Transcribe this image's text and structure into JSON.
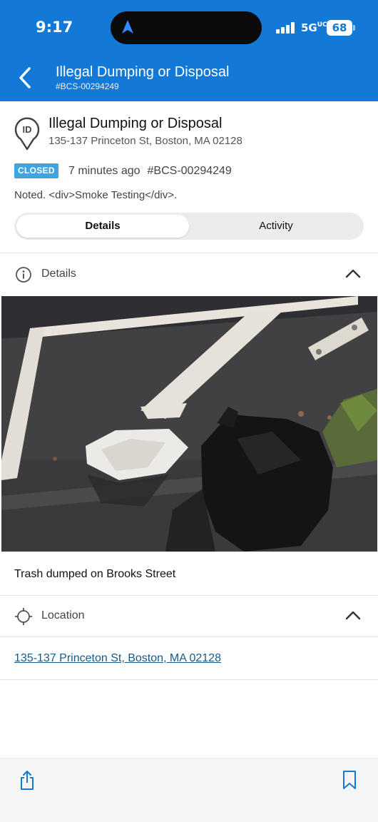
{
  "status_bar": {
    "time": "9:17",
    "network": "5G",
    "network_sup": "UC",
    "battery": "68"
  },
  "nav": {
    "title": "Illegal Dumping or Disposal",
    "subtitle": "#BCS-00294249"
  },
  "case": {
    "title": "Illegal Dumping or Disposal",
    "address": "135-137 Princeton St, Boston, MA 02128",
    "pin_label": "ID",
    "status": "CLOSED",
    "age": "7 minutes ago",
    "id": "#BCS-00294249",
    "note": "Noted. <div>Smoke Testing</div>."
  },
  "tabs": [
    {
      "label": "Details",
      "active": true
    },
    {
      "label": "Activity",
      "active": false
    }
  ],
  "details_section": {
    "label": "Details",
    "icon": "info-icon",
    "photo_alt": "trash-bags-photo",
    "caption": "Trash dumped on Brooks Street"
  },
  "location_section": {
    "label": "Location",
    "icon": "crosshair-icon",
    "address_link": "135-137 Princeton St, Boston, MA 02128"
  },
  "bottom_bar": {
    "share_icon": "share-icon",
    "bookmark_icon": "bookmark-icon"
  },
  "colors": {
    "header": "#1279d6",
    "badge": "#3ea5e0",
    "link": "#1a5a88"
  }
}
